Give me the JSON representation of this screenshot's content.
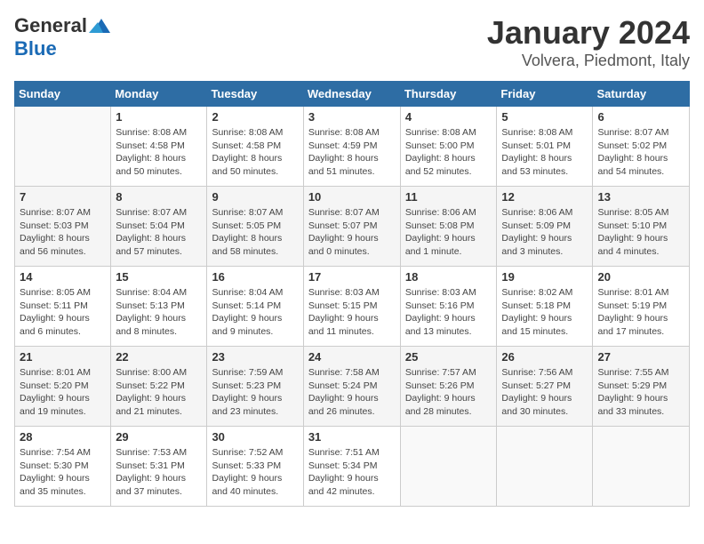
{
  "logo": {
    "general": "General",
    "blue": "Blue"
  },
  "title": {
    "month": "January 2024",
    "location": "Volvera, Piedmont, Italy"
  },
  "days_of_week": [
    "Sunday",
    "Monday",
    "Tuesday",
    "Wednesday",
    "Thursday",
    "Friday",
    "Saturday"
  ],
  "weeks": [
    [
      {
        "day": "",
        "info": ""
      },
      {
        "day": "1",
        "info": "Sunrise: 8:08 AM\nSunset: 4:58 PM\nDaylight: 8 hours\nand 50 minutes."
      },
      {
        "day": "2",
        "info": "Sunrise: 8:08 AM\nSunset: 4:58 PM\nDaylight: 8 hours\nand 50 minutes."
      },
      {
        "day": "3",
        "info": "Sunrise: 8:08 AM\nSunset: 4:59 PM\nDaylight: 8 hours\nand 51 minutes."
      },
      {
        "day": "4",
        "info": "Sunrise: 8:08 AM\nSunset: 5:00 PM\nDaylight: 8 hours\nand 52 minutes."
      },
      {
        "day": "5",
        "info": "Sunrise: 8:08 AM\nSunset: 5:01 PM\nDaylight: 8 hours\nand 53 minutes."
      },
      {
        "day": "6",
        "info": "Sunrise: 8:07 AM\nSunset: 5:02 PM\nDaylight: 8 hours\nand 54 minutes."
      }
    ],
    [
      {
        "day": "7",
        "info": "Sunrise: 8:07 AM\nSunset: 5:03 PM\nDaylight: 8 hours\nand 56 minutes."
      },
      {
        "day": "8",
        "info": "Sunrise: 8:07 AM\nSunset: 5:04 PM\nDaylight: 8 hours\nand 57 minutes."
      },
      {
        "day": "9",
        "info": "Sunrise: 8:07 AM\nSunset: 5:05 PM\nDaylight: 8 hours\nand 58 minutes."
      },
      {
        "day": "10",
        "info": "Sunrise: 8:07 AM\nSunset: 5:07 PM\nDaylight: 9 hours\nand 0 minutes."
      },
      {
        "day": "11",
        "info": "Sunrise: 8:06 AM\nSunset: 5:08 PM\nDaylight: 9 hours\nand 1 minute."
      },
      {
        "day": "12",
        "info": "Sunrise: 8:06 AM\nSunset: 5:09 PM\nDaylight: 9 hours\nand 3 minutes."
      },
      {
        "day": "13",
        "info": "Sunrise: 8:05 AM\nSunset: 5:10 PM\nDaylight: 9 hours\nand 4 minutes."
      }
    ],
    [
      {
        "day": "14",
        "info": "Sunrise: 8:05 AM\nSunset: 5:11 PM\nDaylight: 9 hours\nand 6 minutes."
      },
      {
        "day": "15",
        "info": "Sunrise: 8:04 AM\nSunset: 5:13 PM\nDaylight: 9 hours\nand 8 minutes."
      },
      {
        "day": "16",
        "info": "Sunrise: 8:04 AM\nSunset: 5:14 PM\nDaylight: 9 hours\nand 9 minutes."
      },
      {
        "day": "17",
        "info": "Sunrise: 8:03 AM\nSunset: 5:15 PM\nDaylight: 9 hours\nand 11 minutes."
      },
      {
        "day": "18",
        "info": "Sunrise: 8:03 AM\nSunset: 5:16 PM\nDaylight: 9 hours\nand 13 minutes."
      },
      {
        "day": "19",
        "info": "Sunrise: 8:02 AM\nSunset: 5:18 PM\nDaylight: 9 hours\nand 15 minutes."
      },
      {
        "day": "20",
        "info": "Sunrise: 8:01 AM\nSunset: 5:19 PM\nDaylight: 9 hours\nand 17 minutes."
      }
    ],
    [
      {
        "day": "21",
        "info": "Sunrise: 8:01 AM\nSunset: 5:20 PM\nDaylight: 9 hours\nand 19 minutes."
      },
      {
        "day": "22",
        "info": "Sunrise: 8:00 AM\nSunset: 5:22 PM\nDaylight: 9 hours\nand 21 minutes."
      },
      {
        "day": "23",
        "info": "Sunrise: 7:59 AM\nSunset: 5:23 PM\nDaylight: 9 hours\nand 23 minutes."
      },
      {
        "day": "24",
        "info": "Sunrise: 7:58 AM\nSunset: 5:24 PM\nDaylight: 9 hours\nand 26 minutes."
      },
      {
        "day": "25",
        "info": "Sunrise: 7:57 AM\nSunset: 5:26 PM\nDaylight: 9 hours\nand 28 minutes."
      },
      {
        "day": "26",
        "info": "Sunrise: 7:56 AM\nSunset: 5:27 PM\nDaylight: 9 hours\nand 30 minutes."
      },
      {
        "day": "27",
        "info": "Sunrise: 7:55 AM\nSunset: 5:29 PM\nDaylight: 9 hours\nand 33 minutes."
      }
    ],
    [
      {
        "day": "28",
        "info": "Sunrise: 7:54 AM\nSunset: 5:30 PM\nDaylight: 9 hours\nand 35 minutes."
      },
      {
        "day": "29",
        "info": "Sunrise: 7:53 AM\nSunset: 5:31 PM\nDaylight: 9 hours\nand 37 minutes."
      },
      {
        "day": "30",
        "info": "Sunrise: 7:52 AM\nSunset: 5:33 PM\nDaylight: 9 hours\nand 40 minutes."
      },
      {
        "day": "31",
        "info": "Sunrise: 7:51 AM\nSunset: 5:34 PM\nDaylight: 9 hours\nand 42 minutes."
      },
      {
        "day": "",
        "info": ""
      },
      {
        "day": "",
        "info": ""
      },
      {
        "day": "",
        "info": ""
      }
    ]
  ]
}
